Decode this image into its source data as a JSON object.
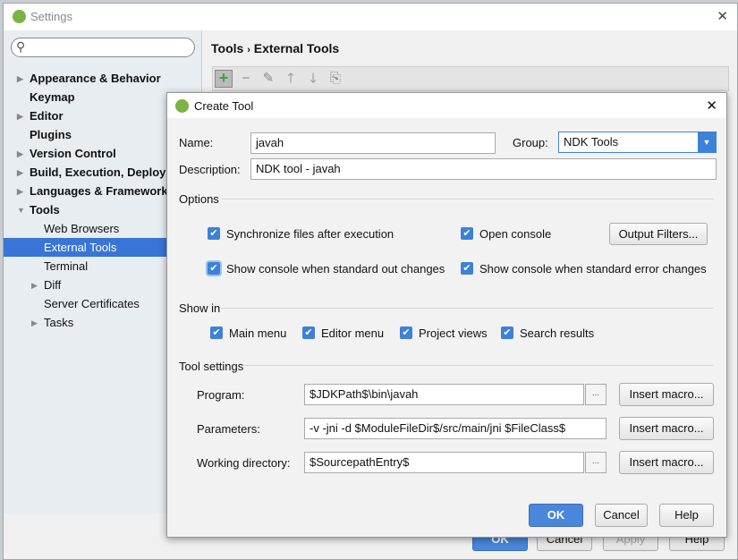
{
  "settings": {
    "title": "Settings",
    "close": "✕",
    "sidebar": [
      {
        "label": "Appearance & Behavior",
        "bold": true,
        "arrow": true,
        "indent": 0
      },
      {
        "label": "Keymap",
        "bold": true,
        "arrow": false,
        "indent": 0
      },
      {
        "label": "Editor",
        "bold": true,
        "arrow": true,
        "indent": 0
      },
      {
        "label": "Plugins",
        "bold": true,
        "arrow": false,
        "indent": 0
      },
      {
        "label": "Version Control",
        "bold": true,
        "arrow": true,
        "indent": 0
      },
      {
        "label": "Build, Execution, Deployment",
        "bold": true,
        "arrow": true,
        "indent": 0
      },
      {
        "label": "Languages & Frameworks",
        "bold": true,
        "arrow": true,
        "indent": 0
      },
      {
        "label": "Tools",
        "bold": true,
        "arrow": true,
        "expanded": true,
        "indent": 0
      },
      {
        "label": "Web Browsers",
        "bold": false,
        "arrow": false,
        "indent": 1
      },
      {
        "label": "External Tools",
        "bold": false,
        "arrow": false,
        "indent": 1,
        "selected": true
      },
      {
        "label": "Terminal",
        "bold": false,
        "arrow": false,
        "indent": 1
      },
      {
        "label": "Diff",
        "bold": false,
        "arrow": true,
        "indent": 1
      },
      {
        "label": "Server Certificates",
        "bold": false,
        "arrow": false,
        "indent": 1
      },
      {
        "label": "Tasks",
        "bold": false,
        "arrow": true,
        "indent": 1
      }
    ],
    "breadcrumb": {
      "parent": "Tools",
      "sep": "›",
      "current": "External Tools"
    },
    "toolbar": {
      "add": "+",
      "remove": "−",
      "edit": "✎",
      "up": "🡑",
      "down": "🡓",
      "copy": "⎘"
    },
    "buttons": {
      "ok": "OK",
      "cancel": "Cancel",
      "apply": "Apply",
      "help": "Help"
    }
  },
  "dialog": {
    "title": "Create Tool",
    "close": "✕",
    "name_label": "Name:",
    "name_value": "javah",
    "group_label": "Group:",
    "group_value": "NDK Tools",
    "description_label": "Description:",
    "description_value": "NDK tool - javah",
    "options_label": "Options",
    "options": [
      {
        "label": "Synchronize files after execution",
        "checked": true
      },
      {
        "label": "Open console",
        "checked": true
      },
      {
        "label": "Show console when standard out changes",
        "checked": true
      },
      {
        "label": "Show console when standard error changes",
        "checked": true
      }
    ],
    "output_filters": "Output Filters...",
    "show_in_label": "Show in",
    "show_in": [
      {
        "label": "Main menu",
        "checked": true
      },
      {
        "label": "Editor menu",
        "checked": true
      },
      {
        "label": "Project views",
        "checked": true
      },
      {
        "label": "Search results",
        "checked": true
      }
    ],
    "tool_settings_label": "Tool settings",
    "program_label": "Program:",
    "program_value": "$JDKPath$\\bin\\javah",
    "parameters_label": "Parameters:",
    "parameters_value": "-v -jni -d $ModuleFileDir$/src/main/jni $FileClass$",
    "workdir_label": "Working directory:",
    "workdir_value": "$SourcepathEntry$",
    "browse": "...",
    "insert_macro": "Insert macro...",
    "ok": "OK",
    "cancel": "Cancel",
    "help": "Help"
  }
}
